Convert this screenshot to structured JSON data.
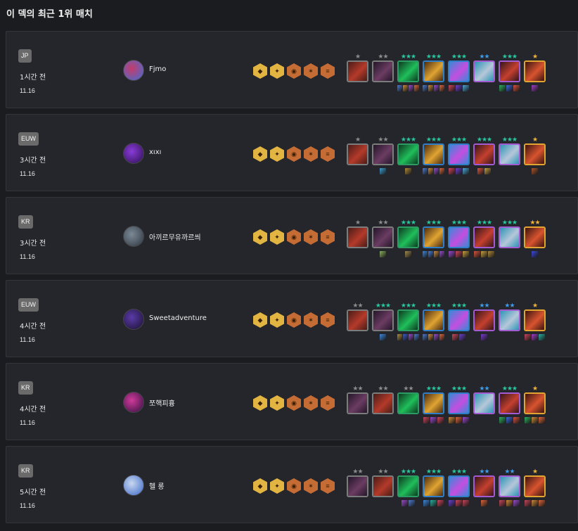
{
  "title": "이 덱의 최근 1위 매치",
  "traits": [
    {
      "icon": "trait-gold-1-icon",
      "tier": "gold",
      "glyph": "◆"
    },
    {
      "icon": "trait-gold-2-icon",
      "tier": "gold",
      "glyph": "✦"
    },
    {
      "icon": "trait-bronze-1-icon",
      "tier": "bronze",
      "glyph": "◉"
    },
    {
      "icon": "trait-bronze-2-icon",
      "tier": "bronze",
      "glyph": "✶"
    },
    {
      "icon": "trait-bronze-3-icon",
      "tier": "bronze",
      "glyph": "≡"
    }
  ],
  "matches": [
    {
      "region": "JP",
      "time": "1시간 전",
      "patch": "11.16",
      "player": "Fjmo",
      "avatar_colors": [
        "#c63b6a",
        "#3f6fd6"
      ],
      "units": [
        {
          "stars": 1,
          "cost": 1,
          "colors": [
            "#b43a2a",
            "#4a1c17"
          ],
          "items": []
        },
        {
          "stars": 2,
          "cost": 1,
          "colors": [
            "#6b3c62",
            "#24162a"
          ],
          "items": []
        },
        {
          "stars": 3,
          "cost": 2,
          "colors": [
            "#1fbf5a",
            "#0d3b21"
          ],
          "items": [
            "#4a7bd6",
            "#d08a39",
            "#9b4ad1",
            "#e0653a"
          ]
        },
        {
          "stars": 3,
          "cost": 3,
          "colors": [
            "#e0a432",
            "#4a2a10"
          ],
          "items": [
            "#4a7bd6",
            "#d08a39",
            "#9b4ad1",
            "#e0653a"
          ]
        },
        {
          "stars": 3,
          "cost": 3,
          "colors": [
            "#c44ee0",
            "#3a89d6"
          ],
          "items": [
            "#d0455a",
            "#6a3fd1",
            "#4aa8d6"
          ]
        },
        {
          "stars": 2,
          "cost": 4,
          "colors": [
            "#b6c7d9",
            "#2c95b6"
          ],
          "items": []
        },
        {
          "stars": 3,
          "cost": 4,
          "colors": [
            "#c5402f",
            "#33161a"
          ],
          "items": [
            "#2db05c",
            "#3a66e0",
            "#d9523a"
          ]
        },
        {
          "stars": 1,
          "cost": 5,
          "colors": [
            "#d9542f",
            "#3a1410"
          ],
          "items": [
            "#a03dc8"
          ]
        }
      ]
    },
    {
      "region": "EUW",
      "time": "3시간 전",
      "patch": "11.16",
      "player": "xıxı",
      "avatar_colors": [
        "#8a3bd8",
        "#2a1050"
      ],
      "units": [
        {
          "stars": 1,
          "cost": 1,
          "colors": [
            "#b43a2a",
            "#4a1c17"
          ],
          "items": []
        },
        {
          "stars": 2,
          "cost": 1,
          "colors": [
            "#6b3c62",
            "#24162a"
          ],
          "items": [
            "#3aa0d6"
          ]
        },
        {
          "stars": 3,
          "cost": 2,
          "colors": [
            "#1fbf5a",
            "#0d3b21"
          ],
          "items": [
            "#b08a3a"
          ]
        },
        {
          "stars": 3,
          "cost": 3,
          "colors": [
            "#e0a432",
            "#4a2a10"
          ],
          "items": [
            "#4a7bd6",
            "#d08a39",
            "#9b4ad1",
            "#e0653a"
          ]
        },
        {
          "stars": 3,
          "cost": 3,
          "colors": [
            "#c44ee0",
            "#3a89d6"
          ],
          "items": [
            "#d0455a",
            "#6a3fd1",
            "#4aa8d6"
          ]
        },
        {
          "stars": 3,
          "cost": 4,
          "colors": [
            "#c5402f",
            "#33161a"
          ],
          "items": [
            "#d9523a",
            "#c8a040"
          ]
        },
        {
          "stars": 3,
          "cost": 4,
          "colors": [
            "#b6c7d9",
            "#2c95b6"
          ],
          "items": []
        },
        {
          "stars": 1,
          "cost": 5,
          "colors": [
            "#d9542f",
            "#3a1410"
          ],
          "items": [
            "#b0552a"
          ]
        }
      ]
    },
    {
      "region": "KR",
      "time": "3시간 전",
      "patch": "11.16",
      "player": "아끼르무유까르씌",
      "avatar_colors": [
        "#7c8a96",
        "#2c3540"
      ],
      "units": [
        {
          "stars": 1,
          "cost": 1,
          "colors": [
            "#b43a2a",
            "#4a1c17"
          ],
          "items": []
        },
        {
          "stars": 2,
          "cost": 1,
          "colors": [
            "#6b3c62",
            "#24162a"
          ],
          "items": [
            "#8ab060"
          ]
        },
        {
          "stars": 3,
          "cost": 2,
          "colors": [
            "#1fbf5a",
            "#0d3b21"
          ],
          "items": [
            "#a08a50"
          ]
        },
        {
          "stars": 3,
          "cost": 3,
          "colors": [
            "#e0a432",
            "#4a2a10"
          ],
          "items": [
            "#3a88e0",
            "#4a7bd6",
            "#d08a39",
            "#9b4ad1"
          ]
        },
        {
          "stars": 3,
          "cost": 3,
          "colors": [
            "#c44ee0",
            "#3a89d6"
          ],
          "items": [
            "#9b4ad1",
            "#d0455a",
            "#c8a040"
          ]
        },
        {
          "stars": 3,
          "cost": 4,
          "colors": [
            "#c5402f",
            "#33161a"
          ],
          "items": [
            "#d9523a",
            "#c8a040",
            "#b08a3a"
          ]
        },
        {
          "stars": 3,
          "cost": 4,
          "colors": [
            "#b6c7d9",
            "#2c95b6"
          ],
          "items": []
        },
        {
          "stars": 2,
          "cost": 5,
          "colors": [
            "#d9542f",
            "#3a1410"
          ],
          "items": [
            "#3a48e0"
          ]
        }
      ]
    },
    {
      "region": "EUW",
      "time": "4시간 전",
      "patch": "11.16",
      "player": "Sweetadventure",
      "avatar_colors": [
        "#5a3ba8",
        "#1a1030"
      ],
      "units": [
        {
          "stars": 2,
          "cost": 1,
          "colors": [
            "#b43a2a",
            "#4a1c17"
          ],
          "items": []
        },
        {
          "stars": 3,
          "cost": 1,
          "colors": [
            "#6b3c62",
            "#24162a"
          ],
          "items": [
            "#3a88e0"
          ]
        },
        {
          "stars": 3,
          "cost": 2,
          "colors": [
            "#1fbf5a",
            "#0d3b21"
          ],
          "items": [
            "#b08a3a",
            "#3a5ad6",
            "#9b4ad1",
            "#4a7bd6"
          ]
        },
        {
          "stars": 3,
          "cost": 3,
          "colors": [
            "#e0a432",
            "#4a2a10"
          ],
          "items": [
            "#4a7bd6",
            "#d08a39",
            "#9b4ad1",
            "#e0653a"
          ]
        },
        {
          "stars": 3,
          "cost": 3,
          "colors": [
            "#c44ee0",
            "#3a89d6"
          ],
          "items": [
            "#d0455a",
            "#6a3fd1"
          ]
        },
        {
          "stars": 2,
          "cost": 4,
          "colors": [
            "#c5402f",
            "#33161a"
          ],
          "items": [
            "#7a3ad1"
          ]
        },
        {
          "stars": 2,
          "cost": 4,
          "colors": [
            "#b6c7d9",
            "#2c95b6"
          ],
          "items": []
        },
        {
          "stars": 1,
          "cost": 5,
          "colors": [
            "#d9542f",
            "#3a1410"
          ],
          "items": [
            "#c8455a",
            "#a03dc8",
            "#2ab0a0"
          ]
        }
      ]
    },
    {
      "region": "KR",
      "time": "4시간 전",
      "patch": "11.16",
      "player": "쪼핵피흉",
      "avatar_colors": [
        "#d03a9a",
        "#301040"
      ],
      "units": [
        {
          "stars": 2,
          "cost": 1,
          "colors": [
            "#6b3c62",
            "#24162a"
          ],
          "items": []
        },
        {
          "stars": 2,
          "cost": 1,
          "colors": [
            "#b43a2a",
            "#4a1c17"
          ],
          "items": []
        },
        {
          "stars": 2,
          "cost": 2,
          "colors": [
            "#1fbf5a",
            "#0d3b21"
          ],
          "items": []
        },
        {
          "stars": 3,
          "cost": 3,
          "colors": [
            "#e0a432",
            "#4a2a10"
          ],
          "items": [
            "#c8455a",
            "#9b4ad1",
            "#d0455a"
          ]
        },
        {
          "stars": 3,
          "cost": 3,
          "colors": [
            "#c44ee0",
            "#3a89d6"
          ],
          "items": [
            "#d08a39",
            "#e0653a",
            "#9b4ad1"
          ]
        },
        {
          "stars": 2,
          "cost": 4,
          "colors": [
            "#b6c7d9",
            "#2c95b6"
          ],
          "items": []
        },
        {
          "stars": 3,
          "cost": 4,
          "colors": [
            "#c5402f",
            "#33161a"
          ],
          "items": [
            "#2db05c",
            "#3a66e0",
            "#d9523a"
          ]
        },
        {
          "stars": 1,
          "cost": 5,
          "colors": [
            "#d9542f",
            "#3a1410"
          ],
          "items": [
            "#2db05c",
            "#d08a39",
            "#e0653a"
          ]
        }
      ]
    },
    {
      "region": "KR",
      "time": "5시간 전",
      "patch": "11.16",
      "player": "헬 롱",
      "avatar_colors": [
        "#c8d8f0",
        "#3a66c8"
      ],
      "units": [
        {
          "stars": 2,
          "cost": 1,
          "colors": [
            "#6b3c62",
            "#24162a"
          ],
          "items": []
        },
        {
          "stars": 2,
          "cost": 1,
          "colors": [
            "#b43a2a",
            "#4a1c17"
          ],
          "items": []
        },
        {
          "stars": 3,
          "cost": 2,
          "colors": [
            "#1fbf5a",
            "#0d3b21"
          ],
          "items": [
            "#9b4ad1",
            "#4a7bd6"
          ]
        },
        {
          "stars": 3,
          "cost": 3,
          "colors": [
            "#e0a432",
            "#4a2a10"
          ],
          "items": [
            "#3a88e0",
            "#2ab0a0",
            "#d0455a"
          ]
        },
        {
          "stars": 3,
          "cost": 3,
          "colors": [
            "#c44ee0",
            "#3a89d6"
          ],
          "items": [
            "#6a3fd1",
            "#d0455a",
            "#c8455a"
          ]
        },
        {
          "stars": 2,
          "cost": 4,
          "colors": [
            "#c5402f",
            "#33161a"
          ],
          "items": [
            "#e0653a"
          ]
        },
        {
          "stars": 2,
          "cost": 4,
          "colors": [
            "#b6c7d9",
            "#2c95b6"
          ],
          "items": [
            "#c8455a",
            "#d08a39",
            "#9b4ad1"
          ]
        },
        {
          "stars": 1,
          "cost": 5,
          "colors": [
            "#d9542f",
            "#3a1410"
          ],
          "items": [
            "#c8455a",
            "#d08a39",
            "#e0653a"
          ]
        }
      ]
    }
  ]
}
